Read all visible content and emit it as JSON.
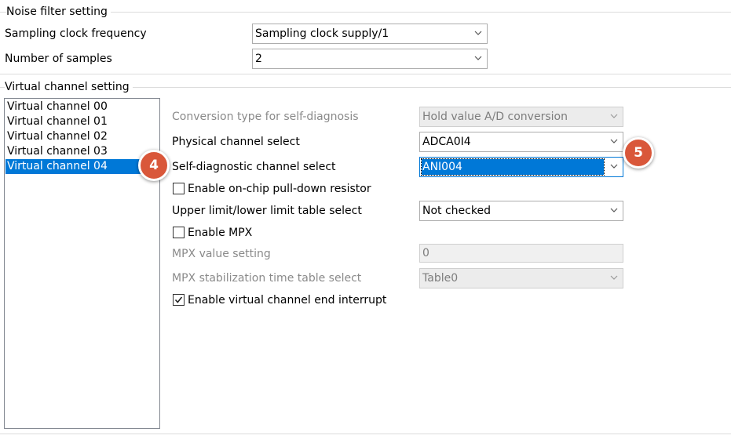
{
  "noise_filter": {
    "title": "Noise filter setting",
    "sampling_clock_label": "Sampling clock frequency",
    "sampling_clock_value": "Sampling clock supply/1",
    "num_samples_label": "Number of samples",
    "num_samples_value": "2"
  },
  "virtual_channel": {
    "title": "Virtual channel setting",
    "channels": [
      "Virtual channel 00",
      "Virtual channel 01",
      "Virtual channel 02",
      "Virtual channel 03",
      "Virtual channel 04"
    ],
    "selected_channel": "Virtual channel 04"
  },
  "settings": {
    "conversion_type_label": "Conversion type for self-diagnosis",
    "conversion_type_value": "Hold value A/D conversion",
    "physical_channel_label": "Physical channel select",
    "physical_channel_value": "ADCA0I4",
    "self_diag_label": "Self-diagnostic channel select",
    "self_diag_value": "ANI004",
    "pulldown_label": "Enable on-chip pull-down resistor",
    "pulldown_checked": false,
    "limit_table_label": "Upper limit/lower limit table select",
    "limit_table_value": "Not checked",
    "mpx_enable_label": "Enable MPX",
    "mpx_enable_checked": false,
    "mpx_value_label": "MPX value setting",
    "mpx_value": "0",
    "mpx_stab_label": "MPX stabilization time table select",
    "mpx_stab_value": "Table0",
    "end_interrupt_label": "Enable virtual channel end interrupt",
    "end_interrupt_checked": true
  },
  "callouts": {
    "step4": "4",
    "step5": "5"
  },
  "colors": {
    "selection": "#0078d7",
    "callout": "#d9573a"
  }
}
